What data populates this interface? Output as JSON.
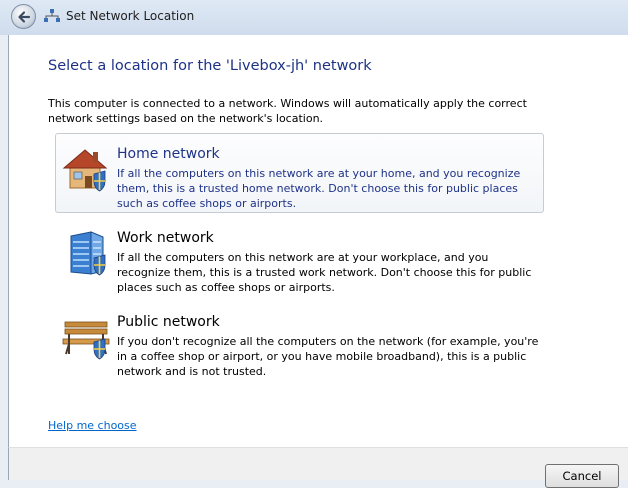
{
  "window": {
    "title": "Set Network Location"
  },
  "main": {
    "heading": "Select a location for the 'Livebox-jh' network",
    "intro": "This computer is connected to a network. Windows will automatically apply the correct network settings based on the network's location."
  },
  "options": [
    {
      "title": "Home network",
      "description": "If all the computers on this network are at your home, and you recognize them, this is a trusted home network.  Don't choose this for public places such as coffee shops or airports.",
      "icon": "home-icon",
      "selected": true
    },
    {
      "title": "Work network",
      "description": "If all the computers on this network are at your workplace, and you recognize them, this is a trusted work network.  Don't choose this for public places such as coffee shops or airports.",
      "icon": "office-building-icon",
      "selected": false
    },
    {
      "title": "Public network",
      "description": "If you don't recognize all the computers on the network (for example, you're in a coffee shop or airport, or you have mobile broadband), this is a public network and is not trusted.",
      "icon": "park-bench-icon",
      "selected": false
    }
  ],
  "help": {
    "link": "Help me choose"
  },
  "footer": {
    "cancel_label": "Cancel"
  },
  "colors": {
    "heading": "#1e3287",
    "link": "#0066cc",
    "titlebar": "#cfdced"
  }
}
